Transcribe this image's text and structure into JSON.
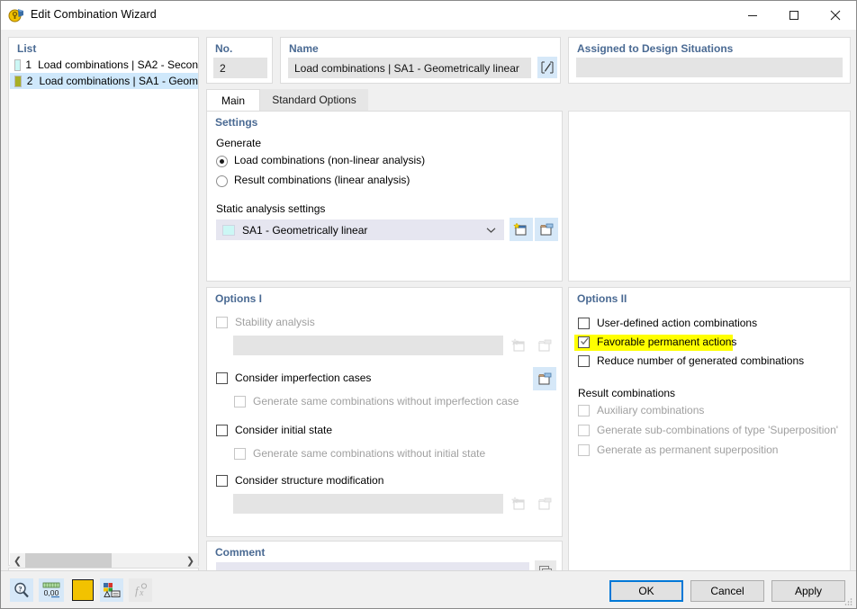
{
  "window": {
    "title": "Edit Combination Wizard",
    "icon": "combination-wizard-icon",
    "minimize_label": "Minimize",
    "maximize_label": "Maximize",
    "close_label": "Close"
  },
  "list_panel": {
    "title": "List",
    "rows": [
      {
        "no": "1",
        "label": "Load combinations | SA2 - Secon",
        "color": "#ccf7f5",
        "selected": false
      },
      {
        "no": "2",
        "label": "Load combinations | SA1 - Geom",
        "color": "#a8b028",
        "selected": true
      }
    ],
    "scroll": {
      "left_arrow": "❮",
      "right_arrow": "❯"
    },
    "toolbar": [
      {
        "name": "new-combination-button",
        "icon": "new-window-icon"
      },
      {
        "name": "copy-combination-button",
        "icon": "copy-window-icon"
      },
      {
        "name": "select-all-button",
        "icon": "check-all-icon"
      },
      {
        "name": "invert-selection-button",
        "icon": "invert-selection-icon"
      },
      {
        "name": "delete-combination-button",
        "icon": "red-x-icon"
      }
    ]
  },
  "number_panel": {
    "title": "No.",
    "value": "2"
  },
  "name_panel": {
    "title": "Name",
    "value": "Load combinations | SA1 - Geometrically linear",
    "edit_button_icon": "pencil-edit-icon"
  },
  "assigned_panel": {
    "title": "Assigned to Design Situations",
    "value": ""
  },
  "tabs": [
    {
      "label": "Main",
      "active": true
    },
    {
      "label": "Standard Options",
      "active": false
    }
  ],
  "settings": {
    "title": "Settings",
    "generate_label": "Generate",
    "radios": [
      {
        "label": "Load combinations (non-linear analysis)",
        "checked": true
      },
      {
        "label": "Result combinations (linear analysis)",
        "checked": false
      }
    ],
    "static_analysis_label": "Static analysis settings",
    "static_analysis_value": "SA1 - Geometrically linear",
    "static_analysis_swatch": "#ccf7f5",
    "new_button_icon": "new-window-icon",
    "edit_button_icon": "edit-window-icon"
  },
  "options1": {
    "title": "Options I",
    "stability_analysis": {
      "label": "Stability analysis",
      "checked": false,
      "enabled": false
    },
    "stability_field": "",
    "stability_new_icon": "new-window-icon",
    "stability_edit_icon": "edit-window-icon",
    "imperfection": {
      "label": "Consider imperfection cases",
      "checked": false,
      "enabled": true
    },
    "imperfection_edit_icon": "edit-window-icon",
    "imperfection_sub": {
      "label": "Generate same combinations without imperfection case",
      "checked": false,
      "enabled": false
    },
    "initial_state": {
      "label": "Consider initial state",
      "checked": false,
      "enabled": true
    },
    "initial_state_sub": {
      "label": "Generate same combinations without initial state",
      "checked": false,
      "enabled": false
    },
    "structure_modification": {
      "label": "Consider structure modification",
      "checked": false,
      "enabled": true
    },
    "structure_field": "",
    "structure_new_icon": "new-window-icon",
    "structure_edit_icon": "edit-window-icon"
  },
  "options2": {
    "title": "Options II",
    "checks": [
      {
        "label": "User-defined action combinations",
        "checked": false,
        "enabled": true,
        "highlighted": false
      },
      {
        "label": "Favorable permanent actions",
        "checked": true,
        "enabled": true,
        "highlighted": true
      },
      {
        "label": "Reduce number of generated combinations",
        "checked": false,
        "enabled": true,
        "highlighted": false
      }
    ],
    "result_combinations_label": "Result combinations",
    "result_checks": [
      {
        "label": "Auxiliary combinations",
        "checked": false,
        "enabled": false
      },
      {
        "label": "Generate sub-combinations of type 'Superposition'",
        "checked": false,
        "enabled": false
      },
      {
        "label": "Generate as permanent superposition",
        "checked": false,
        "enabled": false
      }
    ],
    "highlight_color": "#ffff00"
  },
  "comment_panel": {
    "title": "Comment",
    "value": "",
    "copy_button_icon": "copy-pages-icon"
  },
  "status_bar": [
    {
      "name": "help-search-button",
      "icon": "magnifier-question-icon",
      "enabled": true
    },
    {
      "name": "number-format-button",
      "icon": "number-format-icon",
      "label": "0,00",
      "enabled": true
    },
    {
      "name": "color-swatch-button",
      "icon": "color-swatch-icon",
      "color": "#f2c200",
      "enabled": true
    },
    {
      "name": "display-properties-button",
      "icon": "render-properties-icon",
      "enabled": true
    },
    {
      "name": "formula-button",
      "icon": "fx-function-icon",
      "enabled": false
    }
  ],
  "footer": {
    "ok": "OK",
    "cancel": "Cancel",
    "apply": "Apply"
  }
}
